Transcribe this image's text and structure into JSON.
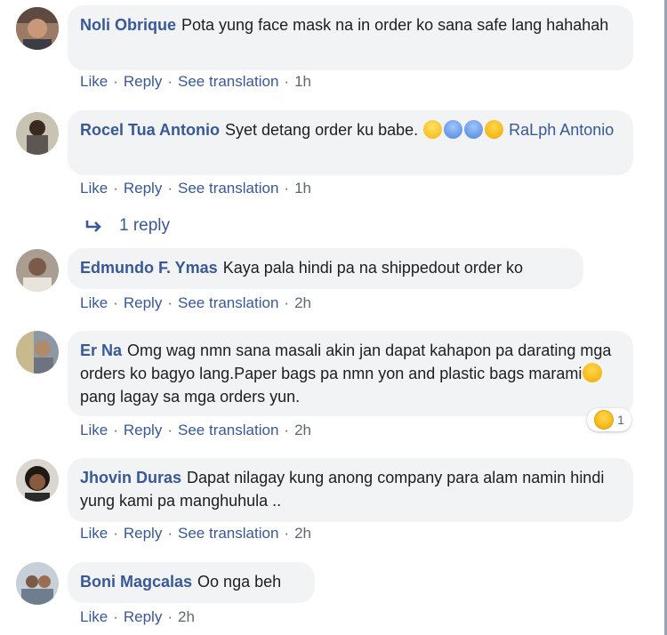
{
  "actions": {
    "like": "Like",
    "reply": "Reply",
    "see_translation": "See translation"
  },
  "comments": [
    {
      "author": "Noli Obrique",
      "text": "Pota yung face mask na in order ko sana safe lang hahahah",
      "time": "1h"
    },
    {
      "author": "Rocel Tua Antonio",
      "text": "Syet detang order ku babe. ",
      "mention": "RaLph Antonio",
      "time": "1h",
      "emojis": [
        "face-screaming-icon",
        "anxious-face-icon",
        "anxious-face-icon",
        "tired-face-icon"
      ]
    },
    {
      "author": "Edmundo F. Ymas",
      "text": "Kaya pala hindi pa na shippedout order ko",
      "time": "2h"
    },
    {
      "author": "Er Na",
      "text_1": "Omg wag nmn sana masali akin jan dapat kahapon pa darating mga orders ko bagyo lang.Paper bags pa nmn yon and plastic bags marami",
      "text_2": " pang lagay sa mga orders yun.",
      "time": "2h",
      "reaction_count": "1"
    },
    {
      "author": "Jhovin Duras",
      "text": "Dapat nilagay kung anong company para alam namin hindi yung kami pa manghuhula ..",
      "time": "2h"
    },
    {
      "author": "Boni Magcalas",
      "text": "Oo nga beh",
      "time": "2h"
    }
  ],
  "replies_link": {
    "label": "1 reply"
  },
  "colors": {
    "link": "#385898",
    "bubble": "#f2f3f5",
    "meta": "#606770"
  }
}
